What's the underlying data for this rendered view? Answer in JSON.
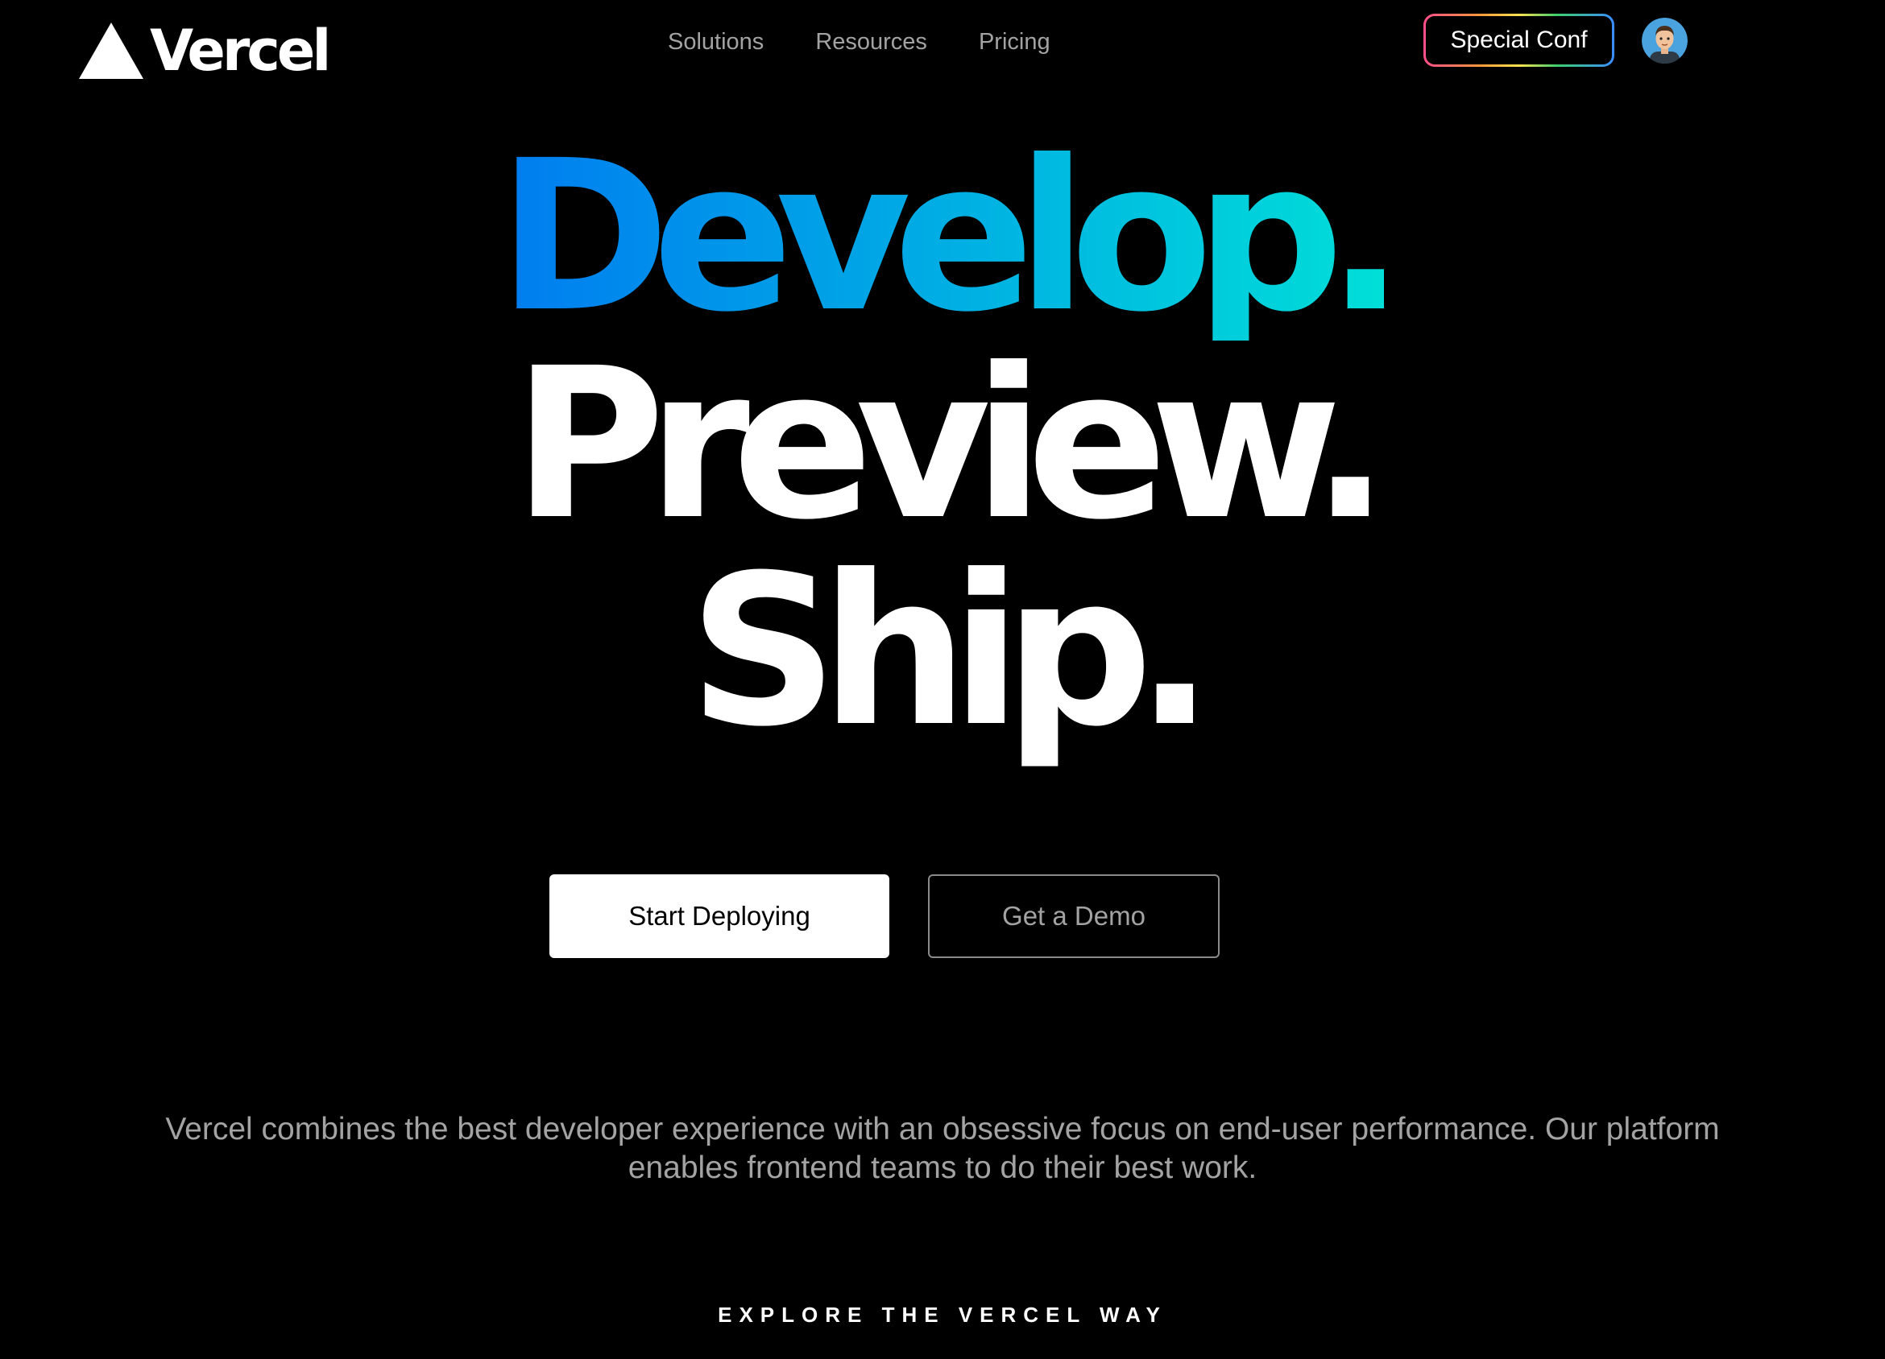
{
  "header": {
    "logo_text": "Vercel",
    "nav": [
      "Solutions",
      "Resources",
      "Pricing"
    ],
    "conf_button": "Special Conf"
  },
  "hero": {
    "line1": "Develop.",
    "line2": "Preview.",
    "line3": "Ship.",
    "gradient": [
      "#007cf0",
      "#00dfd8"
    ]
  },
  "cta": {
    "primary": "Start Deploying",
    "secondary": "Get a Demo"
  },
  "description": "Vercel combines the best developer experience with an obsessive focus on end-user performance. Our platform enables frontend teams to do their best work.",
  "explore_label": "EXPLORE THE VERCEL WAY",
  "colors": {
    "background": "#000000",
    "muted_text": "#a3a3a3"
  },
  "icons": {
    "logo": "vercel-triangle-icon",
    "avatar": "user-avatar"
  }
}
